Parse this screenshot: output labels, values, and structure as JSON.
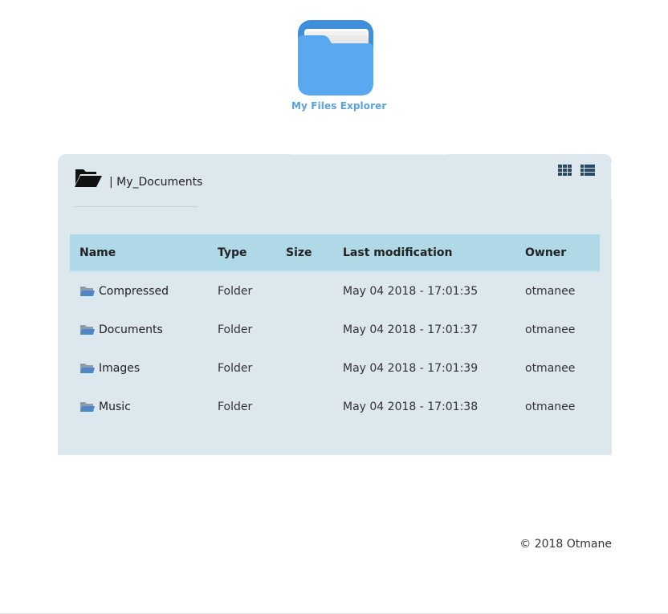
{
  "app": {
    "name": "My Files Explorer",
    "logo_icon": "folder-app-icon",
    "accent_color": "#5aa2e0"
  },
  "breadcrumb": {
    "icon": "folder-open-icon",
    "text": "| My_Documents"
  },
  "view_toggle": {
    "grid_icon": "grid-view-icon",
    "list_icon": "list-view-icon",
    "active": "list"
  },
  "table": {
    "header_color": "#afd9e6",
    "panel_color": "#dde7ee",
    "columns": [
      "Name",
      "Type",
      "Size",
      "Last modification",
      "Owner"
    ],
    "rows": [
      {
        "icon": "folder-icon",
        "name": "Compressed",
        "type": "Folder",
        "size": "",
        "modified": "May 04 2018 - 17:01:35",
        "owner": "otmanee"
      },
      {
        "icon": "folder-icon",
        "name": "Documents",
        "type": "Folder",
        "size": "",
        "modified": "May 04 2018 - 17:01:37",
        "owner": "otmanee"
      },
      {
        "icon": "folder-icon",
        "name": "Images",
        "type": "Folder",
        "size": "",
        "modified": "May 04 2018 - 17:01:39",
        "owner": "otmanee"
      },
      {
        "icon": "folder-icon",
        "name": "Music",
        "type": "Folder",
        "size": "",
        "modified": "May 04 2018 - 17:01:38",
        "owner": "otmanee"
      }
    ]
  },
  "footer": {
    "text": "© 2018 Otmane"
  }
}
